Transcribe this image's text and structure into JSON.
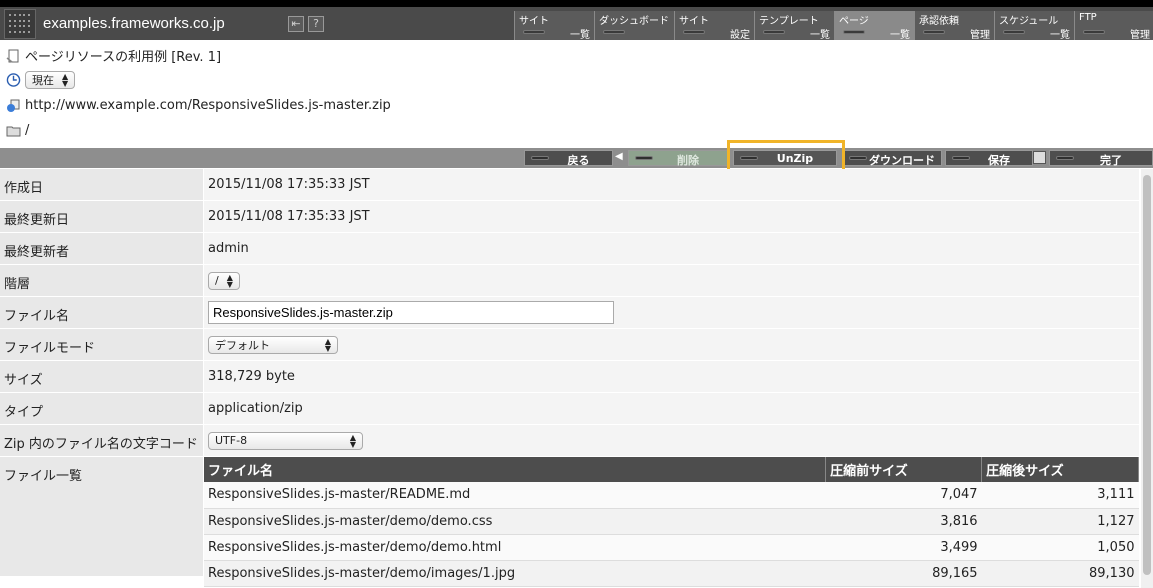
{
  "header": {
    "domain": "examples.frameworks.co.jp",
    "back_icon": "arrow-back-icon",
    "help_icon": "help-icon",
    "help_glyph": "?",
    "menu": [
      {
        "top": "サイト",
        "bottom": "一覧",
        "active": false
      },
      {
        "top": "ダッシュボード",
        "bottom": "",
        "active": false
      },
      {
        "top": "サイト",
        "bottom": "設定",
        "active": false
      },
      {
        "top": "テンプレート",
        "bottom": "一覧",
        "active": false
      },
      {
        "top": "ページ",
        "bottom": "一覧",
        "active": true
      },
      {
        "top": "承認依頼",
        "bottom": "管理",
        "active": false
      },
      {
        "top": "スケジュール",
        "bottom": "一覧",
        "active": false
      },
      {
        "top": "FTP",
        "bottom": "管理",
        "active": false
      }
    ]
  },
  "info": {
    "page_title": "ページリソースの利用例 [Rev. 1]",
    "time_select": "現在",
    "url": "http://www.example.com/ResponsiveSlides.js-master.zip",
    "folder": "/"
  },
  "actions": {
    "back": "戻る",
    "delete": "削除",
    "unzip": "UnZip",
    "download": "ダウンロード",
    "save": "保存",
    "done": "完了"
  },
  "props": {
    "created_label": "作成日",
    "created_value": "2015/11/08 17:35:33 JST",
    "modified_label": "最終更新日",
    "modified_value": "2015/11/08 17:35:33 JST",
    "modifier_label": "最終更新者",
    "modifier_value": "admin",
    "level_label": "階層",
    "level_value": "/",
    "filename_label": "ファイル名",
    "filename_value": "ResponsiveSlides.js-master.zip",
    "filemode_label": "ファイルモード",
    "filemode_value": "デフォルト",
    "size_label": "サイズ",
    "size_value": "318,729 byte",
    "type_label": "タイプ",
    "type_value": "application/zip",
    "encoding_label": "Zip 内のファイル名の文字コード",
    "encoding_value": "UTF-8",
    "filelist_label": "ファイル一覧"
  },
  "filelist": {
    "headers": [
      "ファイル名",
      "圧縮前サイズ",
      "圧縮後サイズ"
    ],
    "rows": [
      [
        "ResponsiveSlides.js-master/README.md",
        "7,047",
        "3,111"
      ],
      [
        "ResponsiveSlides.js-master/demo/demo.css",
        "3,816",
        "1,127"
      ],
      [
        "ResponsiveSlides.js-master/demo/demo.html",
        "3,499",
        "1,050"
      ],
      [
        "ResponsiveSlides.js-master/demo/images/1.jpg",
        "89,165",
        "89,130"
      ]
    ]
  }
}
